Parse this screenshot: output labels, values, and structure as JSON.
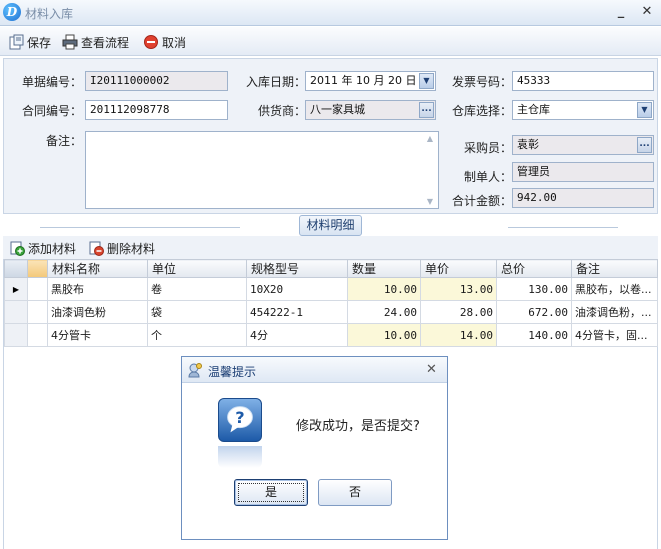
{
  "window": {
    "title": "材料入库"
  },
  "toolbar": {
    "save": "保存",
    "view_flow": "查看流程",
    "cancel": "取消"
  },
  "form": {
    "doc_no_label": "单据编号：",
    "doc_no": "I20111000002",
    "in_date_label": "入库日期：",
    "in_date": "2011 年 10 月 20 日",
    "invoice_label": "发票号码：",
    "invoice": "45333",
    "contract_label": "合同编号：",
    "contract": "201112098778",
    "supplier_label": "供货商：",
    "supplier": "八一家具城",
    "warehouse_label": "仓库选择：",
    "warehouse": "主仓库",
    "remark_label": "备注：",
    "buyer_label": "采购员：",
    "buyer": "袁彰",
    "creator_label": "制单人：",
    "creator": "管理员",
    "total_label": "合计金额：",
    "total": "942.00"
  },
  "detail": {
    "section_title": "材料明细",
    "add_label": "添加材料",
    "delete_label": "删除材料",
    "columns": [
      "材料名称",
      "单位",
      "规格型号",
      "数量",
      "单价",
      "总价",
      "备注"
    ],
    "rows": [
      {
        "name": "黑胶布",
        "unit": "卷",
        "spec": "10X20",
        "qty": "10.00",
        "price": "13.00",
        "total": "130.00",
        "remark": "黑胶布，以卷..."
      },
      {
        "name": "油漆调色粉",
        "unit": "袋",
        "spec": "454222-1",
        "qty": "24.00",
        "price": "28.00",
        "total": "672.00",
        "remark": "油漆调色粉，..."
      },
      {
        "name": "4分管卡",
        "unit": "个",
        "spec": "4分",
        "qty": "10.00",
        "price": "14.00",
        "total": "140.00",
        "remark": "4分管卡，固..."
      }
    ]
  },
  "dialog": {
    "title": "温馨提示",
    "message": "修改成功，是否提交?",
    "yes": "是",
    "no": "否"
  }
}
